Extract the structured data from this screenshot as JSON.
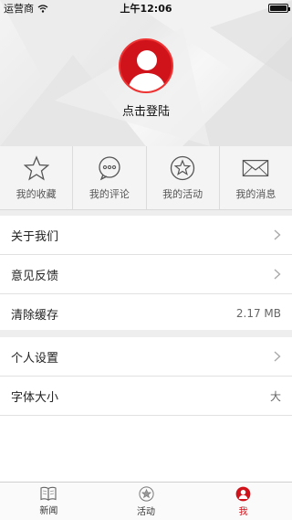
{
  "status_bar": {
    "carrier": "运营商",
    "time": "上午12:06",
    "battery_level": 1.0
  },
  "profile": {
    "login_label": "点击登陆"
  },
  "quick_actions": [
    {
      "label": "我的收藏",
      "icon": "star-icon"
    },
    {
      "label": "我的评论",
      "icon": "comment-icon"
    },
    {
      "label": "我的活动",
      "icon": "badge-star-icon"
    },
    {
      "label": "我的消息",
      "icon": "envelope-icon"
    }
  ],
  "settings_group_1": [
    {
      "label": "关于我们",
      "value": ""
    },
    {
      "label": "意见反馈",
      "value": ""
    },
    {
      "label": "清除缓存",
      "value": "2.17 MB"
    }
  ],
  "settings_group_2": [
    {
      "label": "个人设置",
      "value": ""
    },
    {
      "label": "字体大小",
      "value": "大"
    }
  ],
  "tabbar": [
    {
      "label": "新闻",
      "icon": "book-icon",
      "active": false
    },
    {
      "label": "活动",
      "icon": "badge-star-icon",
      "active": false
    },
    {
      "label": "我",
      "icon": "user-icon",
      "active": true
    }
  ],
  "colors": {
    "accent": "#d0121b",
    "separator": "#eeeeee"
  }
}
